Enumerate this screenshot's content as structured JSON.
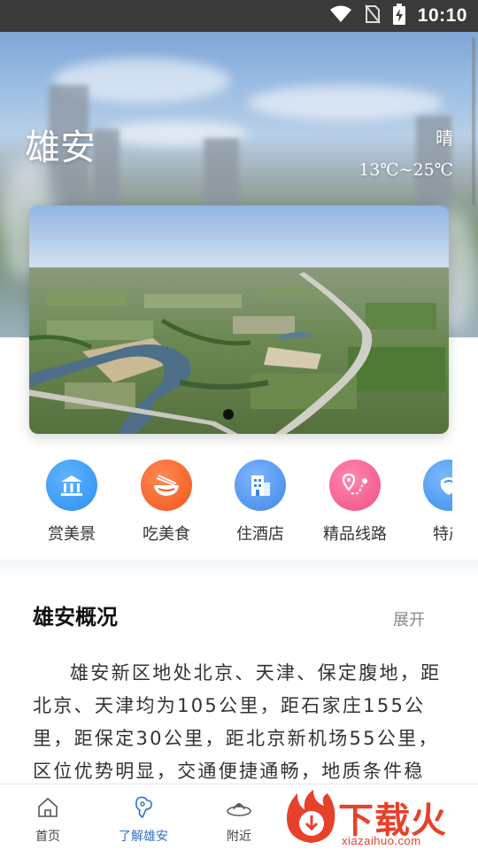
{
  "status_bar": {
    "time": "10:10",
    "icons": [
      "wifi-icon",
      "no-sim-icon",
      "battery-charging-icon"
    ]
  },
  "hero": {
    "city": "雄安",
    "weather_condition": "晴",
    "temperature_range": "13℃~25℃"
  },
  "banner": {
    "slide_count_visible": 1,
    "active_slide": 1
  },
  "categories": [
    {
      "label": "赏美景",
      "icon": "landmark-icon",
      "color": "#2d8ff0"
    },
    {
      "label": "吃美食",
      "icon": "food-bowl-icon",
      "color": "#f2541b"
    },
    {
      "label": "住酒店",
      "icon": "hotel-building-icon",
      "color": "#3f86e6"
    },
    {
      "label": "精品线路",
      "icon": "route-pin-icon",
      "color": "#ef4f86"
    },
    {
      "label": "特产",
      "icon": "specialty-icon",
      "color": "#3b8ee8"
    }
  ],
  "overview": {
    "title": "雄安概况",
    "expand_label": "展开",
    "body": "雄安新区地处北京、天津、保定腹地，距北京、天津均为105公里，距石家庄155公里，距保定30公里，距北京新机场55公里，区位优势明显，交通便捷通畅，地质条件稳"
  },
  "bottom_nav": {
    "items": [
      {
        "label": "首页",
        "icon": "home-icon",
        "active": false
      },
      {
        "label": "了解雄安",
        "icon": "explore-icon",
        "active": true
      },
      {
        "label": "附近",
        "icon": "nearby-icon",
        "active": false
      }
    ],
    "active_color": "#2f6fd0"
  },
  "watermark": {
    "brand_cn": "下载火",
    "brand_url": "xiazaihuo.com",
    "color": "#e8412b"
  }
}
